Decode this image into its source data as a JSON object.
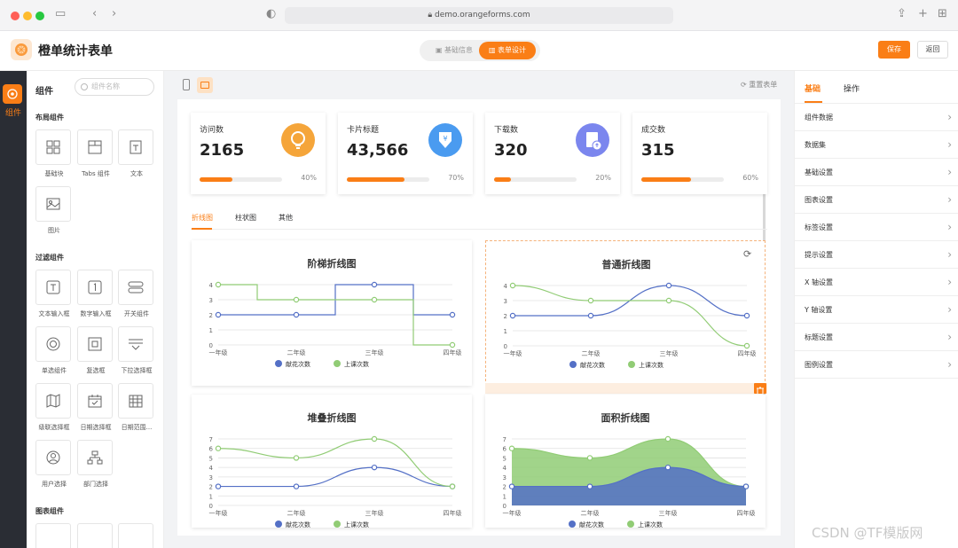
{
  "browser": {
    "url": "demo.orangeforms.com"
  },
  "app": {
    "title": "橙单统计表单",
    "tab_basic": "基础信息",
    "tab_design": "表单设计",
    "save": "保存",
    "back": "返回"
  },
  "rail": {
    "label": "组件"
  },
  "panel": {
    "title": "组件",
    "search_placeholder": "组件名称",
    "groups": [
      {
        "name": "布局组件",
        "items": [
          "基础块",
          "Tabs 组件",
          "文本",
          "图片"
        ]
      },
      {
        "name": "过滤组件",
        "items": [
          "文本输入框",
          "数字输入框",
          "开关组件",
          "单选组件",
          "复选框",
          "下拉选择框",
          "级联选择框",
          "日期选择框",
          "日期范围...",
          "用户选择",
          "部门选择"
        ]
      },
      {
        "name": "图表组件",
        "items": []
      }
    ]
  },
  "toolbar": {
    "reset": "重置表单"
  },
  "cards": [
    {
      "title": "访问数",
      "value": "2165",
      "percent": "40%",
      "progress": 0.4,
      "color": "#f5a53a",
      "icon": "lightbulb-icon"
    },
    {
      "title": "卡片标题",
      "value": "43,566",
      "percent": "70%",
      "progress": 0.7,
      "color": "#4a9bf0",
      "icon": "yen-download-icon"
    },
    {
      "title": "下载数",
      "value": "320",
      "percent": "20%",
      "progress": 0.2,
      "color": "#7b86ee",
      "icon": "file-upload-icon"
    },
    {
      "title": "成交数",
      "value": "315",
      "percent": "60%",
      "progress": 0.6,
      "color": "#fa7e16",
      "icon": "none"
    }
  ],
  "chart_tabs": [
    "折线图",
    "柱状图",
    "其他"
  ],
  "chart_data": [
    {
      "type": "line",
      "title": "阶梯折线图",
      "step": true,
      "categories": [
        "一年级",
        "二年级",
        "三年级",
        "四年级"
      ],
      "ylim": [
        0,
        4
      ],
      "series": [
        {
          "name": "献花次数",
          "values": [
            2,
            2,
            4,
            2
          ],
          "color": "#5470c6"
        },
        {
          "name": "上课次数",
          "values": [
            4,
            3,
            3,
            0
          ],
          "color": "#91cc75"
        }
      ]
    },
    {
      "type": "line",
      "title": "普通折线图",
      "smooth": true,
      "categories": [
        "一年级",
        "二年级",
        "三年级",
        "四年级"
      ],
      "ylim": [
        0,
        4
      ],
      "series": [
        {
          "name": "献花次数",
          "values": [
            2,
            2,
            4,
            2
          ],
          "color": "#5470c6"
        },
        {
          "name": "上课次数",
          "values": [
            4,
            3,
            3,
            0
          ],
          "color": "#91cc75"
        }
      ]
    },
    {
      "type": "line",
      "title": "堆叠折线图",
      "smooth": true,
      "categories": [
        "一年级",
        "二年级",
        "三年级",
        "四年级"
      ],
      "ylim": [
        0,
        7
      ],
      "series": [
        {
          "name": "献花次数",
          "values": [
            2,
            2,
            4,
            2
          ],
          "color": "#5470c6"
        },
        {
          "name": "上课次数",
          "values": [
            6,
            5,
            7,
            2
          ],
          "color": "#91cc75"
        }
      ]
    },
    {
      "type": "area",
      "title": "面积折线图",
      "smooth": true,
      "categories": [
        "一年级",
        "二年级",
        "三年级",
        "四年级"
      ],
      "ylim": [
        0,
        7
      ],
      "series": [
        {
          "name": "献花次数",
          "values": [
            2,
            2,
            4,
            2
          ],
          "color": "#5470c6"
        },
        {
          "name": "上课次数",
          "values": [
            6,
            5,
            7,
            2
          ],
          "color": "#91cc75"
        }
      ]
    }
  ],
  "right": {
    "tabs": [
      "基础",
      "操作"
    ],
    "items": [
      "组件数据",
      "数据集",
      "基础设置",
      "图表设置",
      "标签设置",
      "提示设置",
      "X 轴设置",
      "Y 轴设置",
      "标题设置",
      "图例设置"
    ]
  },
  "watermark": "CSDN @TF模版网"
}
